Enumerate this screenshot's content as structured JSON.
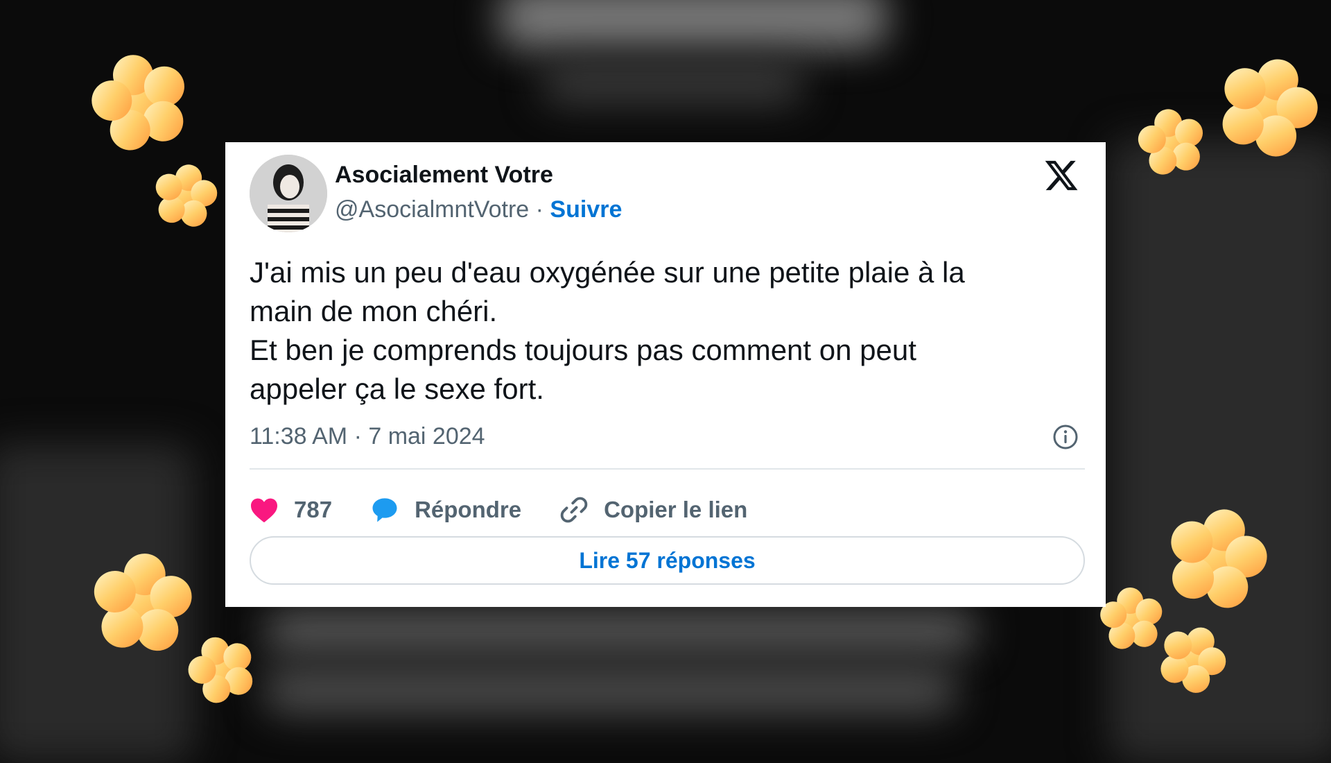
{
  "tweet": {
    "author_name": "Asocialement Votre",
    "handle": "@AsocialmntVotre",
    "separator": "·",
    "follow_label": "Suivre",
    "text": "J'ai mis un peu d'eau oxygénée sur une petite plaie à la\nmain de mon chéri.\nEt ben je comprends toujours pas comment on peut\nappeler ça le sexe fort.",
    "timestamp": "11:38 AM · 7 mai 2024",
    "likes": "787",
    "reply_label": "Répondre",
    "copy_link_label": "Copier le lien",
    "read_replies_label": "Lire 57 réponses"
  },
  "icons": {
    "brand": "x-logo-icon",
    "info": "info-icon",
    "like": "heart-icon",
    "reply": "speech-bubble-icon",
    "link": "link-icon"
  },
  "colors": {
    "accent": "#0074d4",
    "like": "#f91880",
    "reply": "#1d9bf0",
    "flower": "#ffb347"
  }
}
